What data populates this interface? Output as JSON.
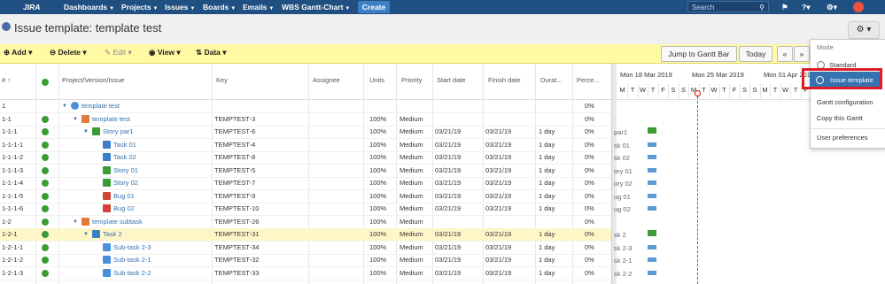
{
  "nav": {
    "logo": "JIRA",
    "items": [
      "Dashboards",
      "Projects",
      "Issues",
      "Boards",
      "Emails",
      "WBS Gantt-Chart"
    ],
    "create": "Create",
    "search_placeholder": "Search"
  },
  "page": {
    "title": "Issue template:  template test"
  },
  "toolbar": {
    "add": "Add",
    "delete": "Delete",
    "edit": "Edit",
    "view": "View",
    "data": "Data",
    "jump": "Jump to Gantt Bar",
    "today": "Today",
    "prev": "«",
    "next": "»"
  },
  "columns": {
    "num": "#",
    "project": "Project/Version/Issue",
    "key": "Key",
    "assignee": "Assignee",
    "units": "Units",
    "priority": "Priority",
    "start": "Start date",
    "finish": "Finish date",
    "duration": "Durat...",
    "percent": "Perce..."
  },
  "rows": [
    {
      "num": "1",
      "name": "template test",
      "key": "",
      "units": "",
      "priority": "",
      "start": "",
      "finish": "",
      "duration": "",
      "percent": "0%"
    },
    {
      "num": "1-1",
      "name": "template test",
      "key": "TEMPTEST-3",
      "units": "100%",
      "priority": "Medium",
      "start": "",
      "finish": "",
      "duration": "",
      "percent": "0%"
    },
    {
      "num": "1-1-1",
      "name": "Story par1",
      "key": "TEMPTEST-6",
      "units": "100%",
      "priority": "Medium",
      "start": "03/21/19",
      "finish": "03/21/19",
      "duration": "1 day",
      "percent": "0%"
    },
    {
      "num": "1-1-1-1",
      "name": "Task 01",
      "key": "TEMPTEST-4",
      "units": "100%",
      "priority": "Medium",
      "start": "03/21/19",
      "finish": "03/21/19",
      "duration": "1 day",
      "percent": "0%"
    },
    {
      "num": "1-1-1-2",
      "name": "Task 02",
      "key": "TEMPTEST-8",
      "units": "100%",
      "priority": "Medium",
      "start": "03/21/19",
      "finish": "03/21/19",
      "duration": "1 day",
      "percent": "0%"
    },
    {
      "num": "1-1-1-3",
      "name": "Story 01",
      "key": "TEMPTEST-5",
      "units": "100%",
      "priority": "Medium",
      "start": "03/21/19",
      "finish": "03/21/19",
      "duration": "1 day",
      "percent": "0%"
    },
    {
      "num": "1-1-1-4",
      "name": "Story 02",
      "key": "TEMPTEST-7",
      "units": "100%",
      "priority": "Medium",
      "start": "03/21/19",
      "finish": "03/21/19",
      "duration": "1 day",
      "percent": "0%"
    },
    {
      "num": "1-1-1-5",
      "name": "Bug 01",
      "key": "TEMPTEST-9",
      "units": "100%",
      "priority": "Medium",
      "start": "03/21/19",
      "finish": "03/21/19",
      "duration": "1 day",
      "percent": "0%"
    },
    {
      "num": "1-1-1-6",
      "name": "Bug 02",
      "key": "TEMPTEST-10",
      "units": "100%",
      "priority": "Medium",
      "start": "03/21/19",
      "finish": "03/21/19",
      "duration": "1 day",
      "percent": "0%"
    },
    {
      "num": "1-2",
      "name": "template subtask",
      "key": "TEMPTEST-26",
      "units": "100%",
      "priority": "Medium",
      "start": "",
      "finish": "",
      "duration": "",
      "percent": "0%"
    },
    {
      "num": "1-2-1",
      "name": "Task 2",
      "key": "TEMPTEST-31",
      "units": "100%",
      "priority": "Medium",
      "start": "03/21/19",
      "finish": "03/21/19",
      "duration": "1 day",
      "percent": "0%"
    },
    {
      "num": "1-2-1-1",
      "name": "Sub-task 2-3",
      "key": "TEMPTEST-34",
      "units": "100%",
      "priority": "Medium",
      "start": "03/21/19",
      "finish": "03/21/19",
      "duration": "1 day",
      "percent": "0%"
    },
    {
      "num": "1-2-1-2",
      "name": "Sub-task 2-1",
      "key": "TEMPTEST-32",
      "units": "100%",
      "priority": "Medium",
      "start": "03/21/19",
      "finish": "03/21/19",
      "duration": "1 day",
      "percent": "0%"
    },
    {
      "num": "1-2-1-3",
      "name": "Sub-task 2-2",
      "key": "TEMPTEST-33",
      "units": "100%",
      "priority": "Medium",
      "start": "03/21/19",
      "finish": "03/21/19",
      "duration": "1 day",
      "percent": "0%"
    }
  ],
  "gantt": {
    "weeks": [
      "Mon 18 Mar 2019",
      "Mon 25 Mar 2019",
      "Mon 01 Apr 2019"
    ],
    "days": [
      "M",
      "T",
      "W",
      "T",
      "F",
      "S",
      "S",
      "M",
      "T",
      "W",
      "T",
      "F",
      "S",
      "S",
      "M",
      "T",
      "W",
      "T",
      "F",
      "S",
      "S"
    ],
    "bar_labels": [
      "par1",
      "sk 01",
      "sk 02",
      "ory 01",
      "ory 02",
      "ug 01",
      "ug 02",
      "sk 2",
      "sk 2-3",
      "sk 2-1",
      "sk 2-2"
    ]
  },
  "menu": {
    "header": "Mode",
    "standard": "Standard",
    "issue_template": "Issue template",
    "gantt_config": "Gantt configuration",
    "copy": "Copy this Gantt",
    "prefs": "User preferences"
  },
  "colors": {
    "nav": "#205081",
    "toolbar": "#fffaa3",
    "highlight": "#e01b24",
    "link": "#3572b0"
  }
}
